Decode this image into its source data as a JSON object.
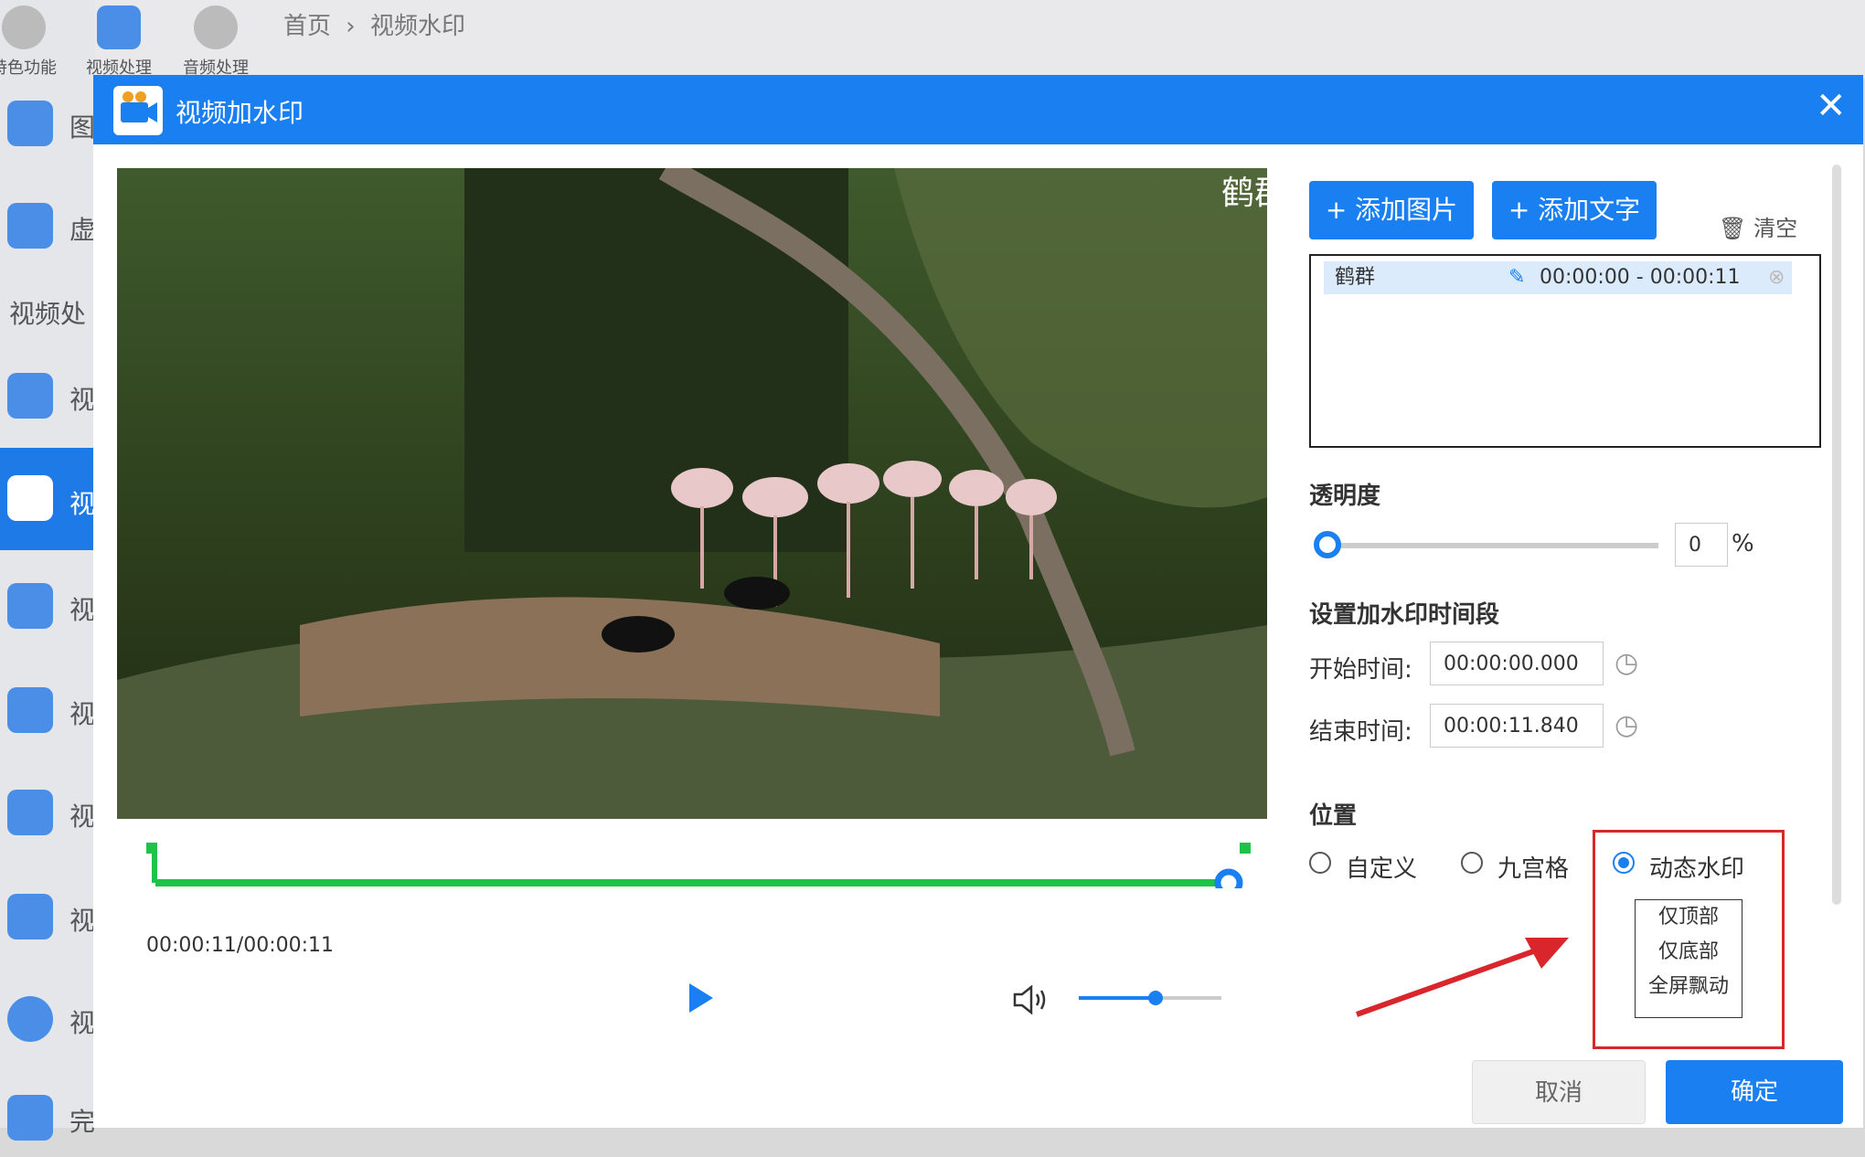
{
  "app": {
    "topnav": [
      {
        "label": "特色功能",
        "color": "#bbbbbb"
      },
      {
        "label": "视频处理",
        "color": "#4a8ee8"
      },
      {
        "label": "音频处理",
        "color": "#bbbbbb"
      }
    ],
    "breadcrumb": {
      "home": "首页",
      "sep": "›",
      "current": "视频水印"
    },
    "sidebar": [
      "图",
      "虚",
      "视频处",
      "视",
      "视",
      "视",
      "视",
      "视",
      "视",
      "视",
      "完"
    ]
  },
  "dialog": {
    "title": "视频加水印",
    "close": "✕",
    "watermark_overlay_text": "鹤群",
    "player": {
      "time": "00:00:11/00:00:11",
      "play_icon": "play-icon",
      "volume_icon": "volume-icon",
      "progress": 1.0,
      "volume": 0.5
    },
    "right": {
      "add_image": "+ 添加图片",
      "add_text": "+ 添加文字",
      "clear": "清空",
      "list": [
        {
          "name": "鹤群",
          "range": "00:00:00  -  00:00:11"
        }
      ],
      "opacity_label": "透明度",
      "opacity_value": "0",
      "opacity_unit": "%",
      "time_section": "设置加水印时间段",
      "start_label": "开始时间:",
      "start_value": "00:00:00.000",
      "end_label": "结束时间:",
      "end_value": "00:00:11.840",
      "position_label": "位置",
      "position_options": [
        "自定义",
        "九宫格",
        "动态水印"
      ],
      "position_selected": "动态水印",
      "dynamic_options": [
        "仅顶部",
        "仅底部",
        "全屏飘动"
      ]
    },
    "footer": {
      "cancel": "取消",
      "ok": "确定"
    }
  },
  "colors": {
    "accent": "#1a7ff0",
    "timeline": "#1fc24a",
    "highlight": "#d8262c"
  }
}
